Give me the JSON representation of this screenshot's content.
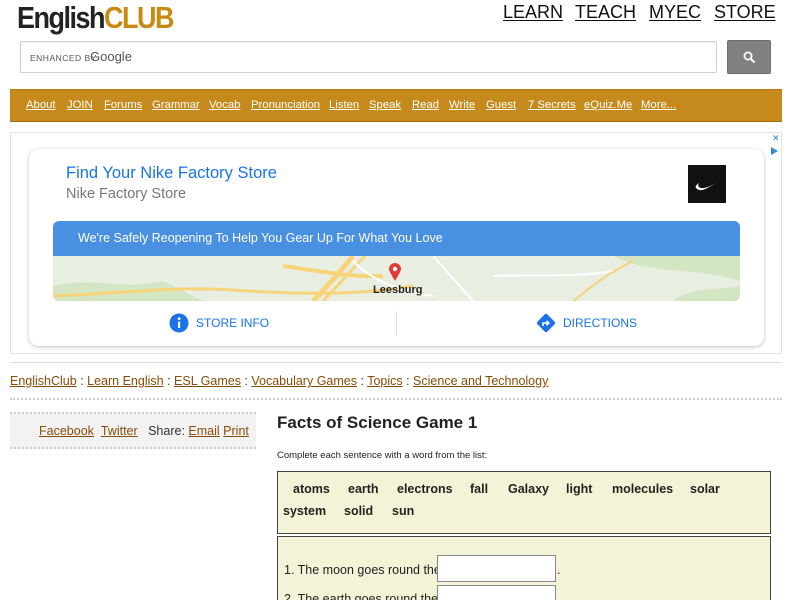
{
  "logo": {
    "part1": "English",
    "part2": "CLUB"
  },
  "topnav": [
    {
      "label": "LEARN",
      "name": "learn"
    },
    {
      "label": "TEACH",
      "name": "teach"
    },
    {
      "label": "MYEC",
      "name": "myec"
    },
    {
      "label": "STORE",
      "name": "store"
    }
  ],
  "search": {
    "enhanced": "ENHANCED BY",
    "google": "Google",
    "placeholder": ""
  },
  "menu": [
    {
      "label": "About",
      "name": "about"
    },
    {
      "label": "JOIN",
      "name": "join"
    },
    {
      "label": "Forums",
      "name": "forums"
    },
    {
      "label": "Grammar",
      "name": "grammar"
    },
    {
      "label": "Vocab",
      "name": "vocab"
    },
    {
      "label": "Pronunciation",
      "name": "pronunciation"
    },
    {
      "label": "Listen",
      "name": "listen"
    },
    {
      "label": "Speak",
      "name": "speak"
    },
    {
      "label": "Read",
      "name": "read"
    },
    {
      "label": "Write",
      "name": "write"
    },
    {
      "label": "Guest",
      "name": "guest"
    },
    {
      "label": "7 Secrets",
      "name": "7-secrets"
    },
    {
      "label": "eQuiz.Me",
      "name": "equiz-me"
    },
    {
      "label": "More...",
      "name": "more"
    }
  ],
  "ad": {
    "close": "✕",
    "title": "Find Your Nike Factory Store",
    "subtitle": "Nike Factory Store",
    "banner": "We're Safely Reopening To Help You Gear Up For What You Love",
    "city": "Leesburg",
    "store_info": "STORE INFO",
    "directions": "DIRECTIONS"
  },
  "breadcrumb": [
    {
      "label": "EnglishClub",
      "name": "englishclub"
    },
    {
      "label": "Learn English",
      "name": "learn-english"
    },
    {
      "label": "ESL Games",
      "name": "esl-games"
    },
    {
      "label": "Vocabulary Games",
      "name": "vocabulary-games"
    },
    {
      "label": "Topics",
      "name": "topics"
    },
    {
      "label": "Science and Technology",
      "name": "science-and-technology"
    }
  ],
  "breadcrumb_sep": " : ",
  "share": {
    "facebook": "Facebook",
    "twitter": "Twitter",
    "share_label": "Share:",
    "email": "Email",
    "print": "Print"
  },
  "main": {
    "title": "Facts of Science Game 1",
    "instruction": "Complete each sentence with a word from the list:",
    "words": [
      "atoms",
      "earth",
      "electrons",
      "fall",
      "Galaxy",
      "light",
      "molecules",
      "solar",
      "system",
      "solid",
      "sun"
    ],
    "questions": [
      {
        "text": "1. The moon goes round the",
        "value": "",
        "end": "."
      },
      {
        "text": "2. The earth goes round the",
        "value": "",
        "end": "."
      }
    ]
  },
  "colors": {
    "brand_gold": "#c68a1c",
    "link_brown": "#8a4b08",
    "ad_blue": "#1a73e8",
    "word_box": "#f5f3d7"
  }
}
